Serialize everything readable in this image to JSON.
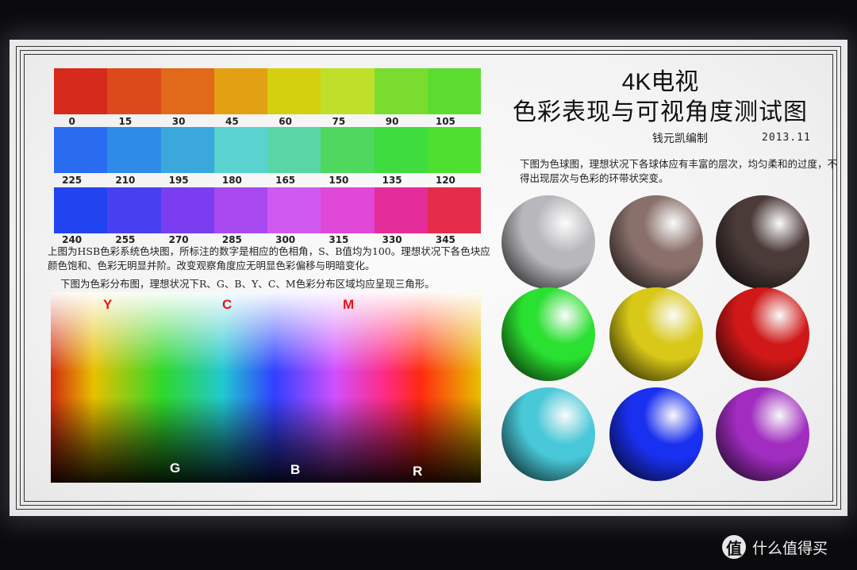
{
  "rows": [
    {
      "labels": [
        "0",
        "15",
        "30",
        "45",
        "60",
        "75",
        "90",
        "105"
      ],
      "colors": [
        "#d62a1c",
        "#dc4a1c",
        "#e06a1a",
        "#e2a012",
        "#d4d010",
        "#bee02a",
        "#7adc2e",
        "#5cdc30"
      ]
    },
    {
      "labels": [
        "225",
        "210",
        "195",
        "180",
        "165",
        "150",
        "135",
        "120"
      ],
      "colors": [
        "#2a6cf0",
        "#2e8ce8",
        "#3aa8dc",
        "#5ad2d0",
        "#5ad6a6",
        "#4ed860",
        "#3edc3e",
        "#4ee030"
      ]
    },
    {
      "labels": [
        "240",
        "255",
        "270",
        "285",
        "300",
        "315",
        "330",
        "345"
      ],
      "colors": [
        "#2244f0",
        "#4840f0",
        "#7a3ef0",
        "#a84af0",
        "#d05af0",
        "#e048d8",
        "#e42c9a",
        "#e42c4a"
      ]
    }
  ],
  "text": {
    "hsb_para": "上图为HSB色彩系统色块图，所标注的数字是相应的色相角，S、B值均为100。理想状况下各色块应颜色饱和、色彩无明显并阶。改变观察角度应无明显色彩偏移与明暗变化。",
    "dist_para": "下图为色彩分布图，理想状况下R、G、B、Y、C、M色彩分布区域均应呈现三角形。",
    "title_line1": "4K电视",
    "title_line2": "色彩表现与可视角度测试图",
    "author": "钱元凯编制",
    "date": "2013.11",
    "sphere_para": "下图为色球图，理想状况下各球体应有丰富的层次，均匀柔和的过度，不得出现层次与色彩的环带状突变。"
  },
  "distribution_labels": {
    "top": [
      "Y",
      "C",
      "M"
    ],
    "bottom": [
      "G",
      "B",
      "R"
    ],
    "top_color": "#e01818",
    "bottom_color": "#ffffff"
  },
  "spheres": [
    {
      "name": "gray",
      "color": "#b8b8bc"
    },
    {
      "name": "brown",
      "color": "#8a706a"
    },
    {
      "name": "dark-brown",
      "color": "#4a3a38"
    },
    {
      "name": "green",
      "color": "#2ae030"
    },
    {
      "name": "yellow",
      "color": "#d8c818"
    },
    {
      "name": "red",
      "color": "#d01818"
    },
    {
      "name": "cyan",
      "color": "#48c8d8"
    },
    {
      "name": "blue",
      "color": "#1a30f0"
    },
    {
      "name": "purple",
      "color": "#a02cc0"
    }
  ],
  "watermark": {
    "icon": "值",
    "text": "什么值得买"
  }
}
